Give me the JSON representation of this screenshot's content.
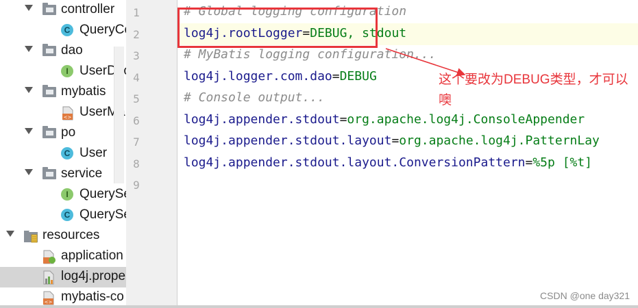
{
  "tree": {
    "items": [
      {
        "label": "controller",
        "kind": "folder",
        "expanded": true
      },
      {
        "label": "QueryCo",
        "kind": "class"
      },
      {
        "label": "dao",
        "kind": "folder",
        "expanded": true
      },
      {
        "label": "UserDao",
        "kind": "interface"
      },
      {
        "label": "mybatis",
        "kind": "folder",
        "expanded": true
      },
      {
        "label": "UserMa",
        "kind": "xml"
      },
      {
        "label": "po",
        "kind": "folder",
        "expanded": true
      },
      {
        "label": "User",
        "kind": "class"
      },
      {
        "label": "service",
        "kind": "folder",
        "expanded": true
      },
      {
        "label": "QuerySe",
        "kind": "interface"
      },
      {
        "label": "QuerySe",
        "kind": "class"
      },
      {
        "label": "resources",
        "kind": "resources-folder",
        "expanded": true
      },
      {
        "label": "application",
        "kind": "spring-config"
      },
      {
        "label": "log4j.prope",
        "kind": "properties",
        "selected": true
      },
      {
        "label": "mybatis-co",
        "kind": "xml"
      }
    ]
  },
  "editor": {
    "line_numbers": [
      "1",
      "2",
      "3",
      "4",
      "5",
      "6",
      "7",
      "8",
      "9"
    ],
    "lines": [
      {
        "comment": "# Global logging configuration"
      },
      {
        "key": "log4j.rootLogger",
        "eq": "=",
        "val": "DEBUG, stdout"
      },
      {
        "comment": "# MyBatis logging configuration..."
      },
      {
        "key": "log4j.logger.com.dao",
        "eq": "=",
        "val": "DEBUG"
      },
      {
        "comment": "# Console output..."
      },
      {
        "key": "log4j.appender.stdout",
        "eq": "=",
        "val": "org.apache.log4j.ConsoleAppender"
      },
      {
        "key": "log4j.appender.stdout.layout",
        "eq": "=",
        "val": "org.apache.log4j.PatternLay"
      },
      {
        "key": "log4j.appender.stdout.layout.ConversionPattern",
        "eq": "=",
        "val": "%5p [%t]"
      },
      {}
    ]
  },
  "annotation": {
    "note": "这个要改为DEBUG类型，才可以噢",
    "color": "#e8353b"
  },
  "watermark": "CSDN @one day321"
}
